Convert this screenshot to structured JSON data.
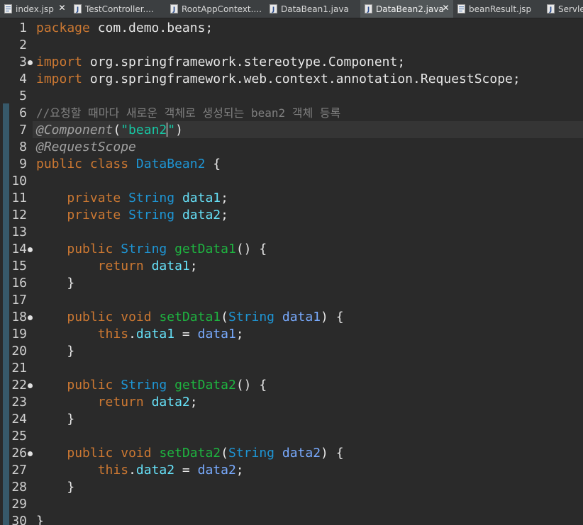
{
  "tabs": [
    {
      "label": "index.jsp",
      "icon": "jsp-file-icon",
      "active": false,
      "closable": true
    },
    {
      "label": "TestController....",
      "icon": "java-file-icon",
      "active": false,
      "closable": false
    },
    {
      "label": "RootAppContext....",
      "icon": "java-file-icon",
      "active": false,
      "closable": false
    },
    {
      "label": "DataBean1.java",
      "icon": "java-file-icon",
      "active": false,
      "closable": false
    },
    {
      "label": "DataBean2.java",
      "icon": "java-file-icon",
      "active": true,
      "closable": true
    },
    {
      "label": "beanResult.jsp",
      "icon": "jsp-file-icon",
      "active": false,
      "closable": false
    },
    {
      "label": "ServletAppCon...",
      "icon": "java-file-icon",
      "active": false,
      "closable": false
    }
  ],
  "editor": {
    "lines": [
      {
        "n": "1",
        "tokens": [
          [
            "kw",
            "package"
          ],
          [
            "plain",
            " com.demo.beans;"
          ]
        ]
      },
      {
        "n": "2",
        "tokens": []
      },
      {
        "n": "3",
        "fold": true,
        "tokens": [
          [
            "kw",
            "import"
          ],
          [
            "plain",
            " org.springframework.stereotype.Component;"
          ]
        ]
      },
      {
        "n": "4",
        "tokens": [
          [
            "kw",
            "import"
          ],
          [
            "plain",
            " org.springframework.web.context.annotation.RequestScope;"
          ]
        ]
      },
      {
        "n": "5",
        "tokens": []
      },
      {
        "n": "6",
        "tokens": [
          [
            "cmt",
            "//요청할 때마다 새로운 객체로 생성되는 bean2 객체 등록"
          ]
        ]
      },
      {
        "n": "7",
        "current": true,
        "tokens": [
          [
            "ann",
            "@Component"
          ],
          [
            "plain",
            "("
          ],
          [
            "str",
            "\"bean2"
          ],
          [
            "cursor",
            ""
          ],
          [
            "str",
            "\""
          ],
          [
            "plain",
            ")"
          ]
        ]
      },
      {
        "n": "8",
        "tokens": [
          [
            "ann",
            "@RequestScope"
          ]
        ]
      },
      {
        "n": "9",
        "tokens": [
          [
            "kw",
            "public"
          ],
          [
            "plain",
            " "
          ],
          [
            "kw",
            "class"
          ],
          [
            "plain",
            " "
          ],
          [
            "typ",
            "DataBean2"
          ],
          [
            "plain",
            " {"
          ]
        ]
      },
      {
        "n": "10",
        "tokens": []
      },
      {
        "n": "11",
        "tokens": [
          [
            "plain",
            "    "
          ],
          [
            "kw",
            "private"
          ],
          [
            "plain",
            " "
          ],
          [
            "typ",
            "String"
          ],
          [
            "plain",
            " "
          ],
          [
            "fld",
            "data1"
          ],
          [
            "plain",
            ";"
          ]
        ]
      },
      {
        "n": "12",
        "tokens": [
          [
            "plain",
            "    "
          ],
          [
            "kw",
            "private"
          ],
          [
            "plain",
            " "
          ],
          [
            "typ",
            "String"
          ],
          [
            "plain",
            " "
          ],
          [
            "fld",
            "data2"
          ],
          [
            "plain",
            ";"
          ]
        ]
      },
      {
        "n": "13",
        "tokens": []
      },
      {
        "n": "14",
        "fold": true,
        "tokens": [
          [
            "plain",
            "    "
          ],
          [
            "kw",
            "public"
          ],
          [
            "plain",
            " "
          ],
          [
            "typ",
            "String"
          ],
          [
            "plain",
            " "
          ],
          [
            "mth",
            "getData1"
          ],
          [
            "plain",
            "() {"
          ]
        ]
      },
      {
        "n": "15",
        "tokens": [
          [
            "plain",
            "        "
          ],
          [
            "kw",
            "return"
          ],
          [
            "plain",
            " "
          ],
          [
            "fld",
            "data1"
          ],
          [
            "plain",
            ";"
          ]
        ]
      },
      {
        "n": "16",
        "tokens": [
          [
            "plain",
            "    }"
          ]
        ]
      },
      {
        "n": "17",
        "tokens": []
      },
      {
        "n": "18",
        "fold": true,
        "tokens": [
          [
            "plain",
            "    "
          ],
          [
            "kw",
            "public"
          ],
          [
            "plain",
            " "
          ],
          [
            "kw",
            "void"
          ],
          [
            "plain",
            " "
          ],
          [
            "mth",
            "setData1"
          ],
          [
            "plain",
            "("
          ],
          [
            "typ",
            "String"
          ],
          [
            "plain",
            " "
          ],
          [
            "prm",
            "data1"
          ],
          [
            "plain",
            ") {"
          ]
        ]
      },
      {
        "n": "19",
        "tokens": [
          [
            "plain",
            "        "
          ],
          [
            "kw",
            "this"
          ],
          [
            "plain",
            "."
          ],
          [
            "fld",
            "data1"
          ],
          [
            "plain",
            " = "
          ],
          [
            "prm",
            "data1"
          ],
          [
            "plain",
            ";"
          ]
        ]
      },
      {
        "n": "20",
        "tokens": [
          [
            "plain",
            "    }"
          ]
        ]
      },
      {
        "n": "21",
        "tokens": []
      },
      {
        "n": "22",
        "fold": true,
        "tokens": [
          [
            "plain",
            "    "
          ],
          [
            "kw",
            "public"
          ],
          [
            "plain",
            " "
          ],
          [
            "typ",
            "String"
          ],
          [
            "plain",
            " "
          ],
          [
            "mth",
            "getData2"
          ],
          [
            "plain",
            "() {"
          ]
        ]
      },
      {
        "n": "23",
        "tokens": [
          [
            "plain",
            "        "
          ],
          [
            "kw",
            "return"
          ],
          [
            "plain",
            " "
          ],
          [
            "fld",
            "data2"
          ],
          [
            "plain",
            ";"
          ]
        ]
      },
      {
        "n": "24",
        "tokens": [
          [
            "plain",
            "    }"
          ]
        ]
      },
      {
        "n": "25",
        "tokens": []
      },
      {
        "n": "26",
        "fold": true,
        "tokens": [
          [
            "plain",
            "    "
          ],
          [
            "kw",
            "public"
          ],
          [
            "plain",
            " "
          ],
          [
            "kw",
            "void"
          ],
          [
            "plain",
            " "
          ],
          [
            "mth",
            "setData2"
          ],
          [
            "plain",
            "("
          ],
          [
            "typ",
            "String"
          ],
          [
            "plain",
            " "
          ],
          [
            "prm",
            "data2"
          ],
          [
            "plain",
            ") {"
          ]
        ]
      },
      {
        "n": "27",
        "tokens": [
          [
            "plain",
            "        "
          ],
          [
            "kw",
            "this"
          ],
          [
            "plain",
            "."
          ],
          [
            "fld",
            "data2"
          ],
          [
            "plain",
            " = "
          ],
          [
            "prm",
            "data2"
          ],
          [
            "plain",
            ";"
          ]
        ]
      },
      {
        "n": "28",
        "tokens": [
          [
            "plain",
            "    }"
          ]
        ]
      },
      {
        "n": "29",
        "tokens": []
      },
      {
        "n": "30",
        "tokens": [
          [
            "plain",
            "}"
          ]
        ]
      }
    ]
  },
  "colors": {
    "background": "#2b2b2b",
    "keyword": "#cc7832",
    "type": "#1e95d4",
    "field": "#66e1f8",
    "parameter": "#79abff",
    "method": "#1eb540",
    "string": "#17c6a3",
    "comment": "#808080"
  }
}
